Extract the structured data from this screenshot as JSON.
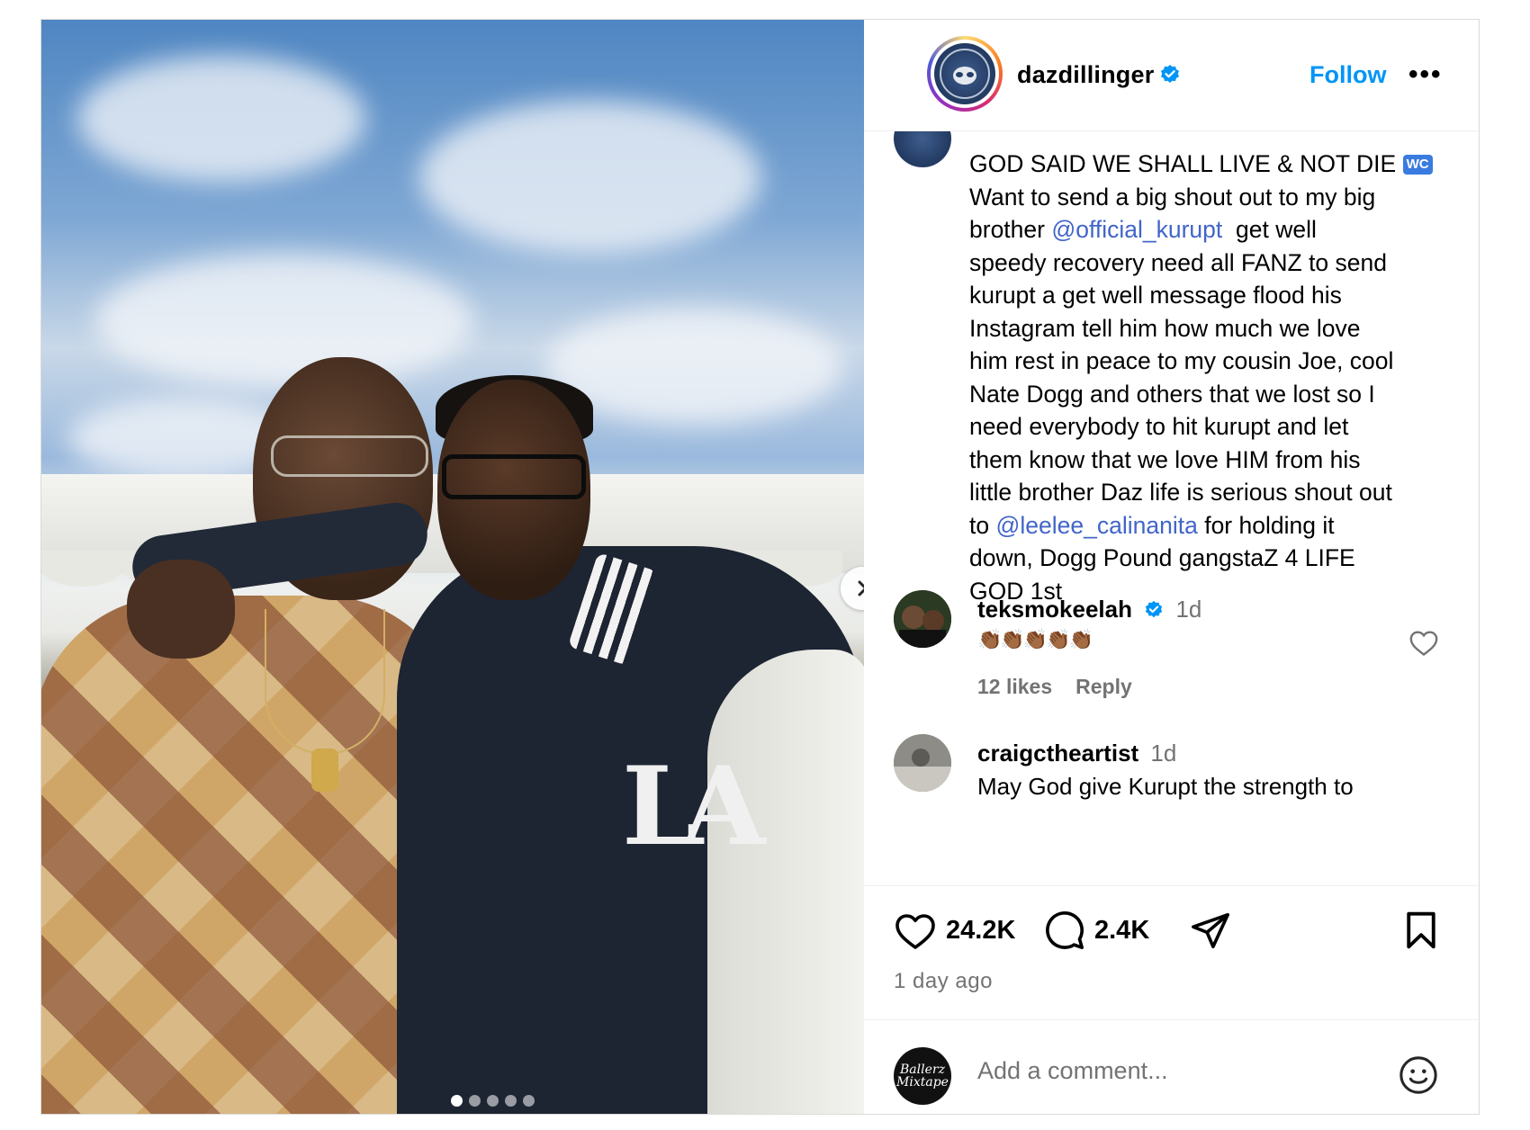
{
  "post": {
    "username": "dazdillinger",
    "follow_label": "Follow",
    "more_label": "•••",
    "caption_lines": [
      "GOD SAID WE SHALL LIVE & NOT DIE",
      "Want to send a big shout out to my big",
      "brother",
      "get well",
      "speedy recovery need all FANZ to send",
      "kurupt a get well message flood his",
      "Instagram tell him how much we love",
      "him rest in peace to my cousin Joe, cool",
      "Nate Dogg and others that we lost so I",
      "need everybody to hit kurupt and let",
      "them know that we love HIM from his",
      "little brother Daz life is serious shout out",
      "to",
      "for holding it",
      "down, Dogg Pound gangstaZ 4 LIFE",
      "GOD 1st"
    ],
    "wc_badge": "WC",
    "mention_1": "@official_kurupt",
    "mention_2": "@leelee_calinanita",
    "image_logo_text": "LA",
    "carousel_total": 5,
    "carousel_active": 1
  },
  "comments": [
    {
      "user": "teksmokeelah",
      "time": "1d",
      "text": "👏🏾👏🏾👏🏾👏🏾👏🏾",
      "likes": "12 likes",
      "reply": "Reply",
      "verified": true
    },
    {
      "user": "craigctheartist",
      "time": "1d",
      "text": "May God give Kurupt the strength to",
      "verified": false
    }
  ],
  "actions": {
    "like_count": "24.2K",
    "comment_count": "2.4K",
    "time_ago": "1 day ago"
  },
  "add_comment": {
    "placeholder": "Add a comment...",
    "avatar_text": "Ballerz Mixtape"
  },
  "colors": {
    "link": "#0095f6",
    "mention": "#4165c9",
    "muted": "#737373",
    "verified": "#0095f6"
  }
}
